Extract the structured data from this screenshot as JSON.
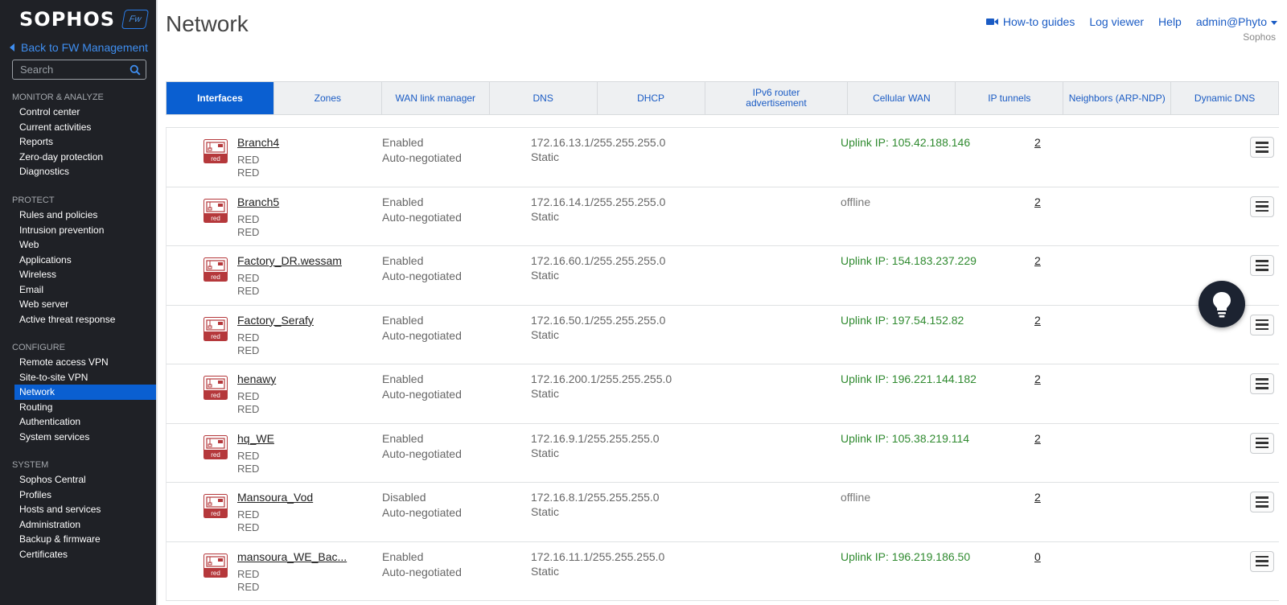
{
  "sidebar": {
    "logo": "SOPHOS",
    "badge": "Fw",
    "back_link": "Back to FW Management",
    "search_placeholder": "Search",
    "sections": {
      "monitor": {
        "heading": "MONITOR & ANALYZE",
        "items": [
          "Control center",
          "Current activities",
          "Reports",
          "Zero-day protection",
          "Diagnostics"
        ]
      },
      "protect": {
        "heading": "PROTECT",
        "items": [
          "Rules and policies",
          "Intrusion prevention",
          "Web",
          "Applications",
          "Wireless",
          "Email",
          "Web server",
          "Active threat response"
        ]
      },
      "configure": {
        "heading": "CONFIGURE",
        "items": [
          "Remote access VPN",
          "Site-to-site VPN",
          "Network",
          "Routing",
          "Authentication",
          "System services"
        ]
      },
      "system": {
        "heading": "SYSTEM",
        "items": [
          "Sophos Central",
          "Profiles",
          "Hosts and services",
          "Administration",
          "Backup & firmware",
          "Certificates"
        ]
      }
    },
    "active_item": "Network"
  },
  "header": {
    "title": "Network",
    "how_to": "How-to guides",
    "log_viewer": "Log viewer",
    "help": "Help",
    "user": "admin@Phyto",
    "org": "Sophos"
  },
  "tabs": [
    {
      "label": "Interfaces",
      "active": true
    },
    {
      "label": "Zones"
    },
    {
      "label": "WAN link manager"
    },
    {
      "label": "DNS"
    },
    {
      "label": "DHCP"
    },
    {
      "label": "IPv6 router advertisement"
    },
    {
      "label": "Cellular WAN"
    },
    {
      "label": "IP tunnels"
    },
    {
      "label": "Neighbors (ARP-NDP)"
    },
    {
      "label": "Dynamic DNS"
    }
  ],
  "rows": [
    {
      "name": "Branch4",
      "type1": "RED",
      "type2": "RED",
      "status": "Enabled",
      "negotiation": "Auto-negotiated",
      "ip": "172.16.13.1/255.255.255.0",
      "mode": "Static",
      "uplink": "Uplink IP: 105.42.188.146",
      "online": true,
      "count": "2",
      "icon_label": "red"
    },
    {
      "name": "Branch5",
      "type1": "RED",
      "type2": "RED",
      "status": "Enabled",
      "negotiation": "Auto-negotiated",
      "ip": "172.16.14.1/255.255.255.0",
      "mode": "Static",
      "uplink": "offline",
      "online": false,
      "count": "2",
      "icon_label": "red"
    },
    {
      "name": "Factory_DR.wessam",
      "type1": "RED",
      "type2": "RED",
      "status": "Enabled",
      "negotiation": "Auto-negotiated",
      "ip": "172.16.60.1/255.255.255.0",
      "mode": "Static",
      "uplink": "Uplink IP: 154.183.237.229",
      "online": true,
      "count": "2",
      "icon_label": "red"
    },
    {
      "name": "Factory_Serafy",
      "type1": "RED",
      "type2": "RED",
      "status": "Enabled",
      "negotiation": "Auto-negotiated",
      "ip": "172.16.50.1/255.255.255.0",
      "mode": "Static",
      "uplink": "Uplink IP: 197.54.152.82",
      "online": true,
      "count": "2",
      "icon_label": "red"
    },
    {
      "name": "henawy",
      "type1": "RED",
      "type2": "RED",
      "status": "Enabled",
      "negotiation": "Auto-negotiated",
      "ip": "172.16.200.1/255.255.255.0",
      "mode": "Static",
      "uplink": "Uplink IP: 196.221.144.182",
      "online": true,
      "count": "2",
      "icon_label": "red"
    },
    {
      "name": "hq_WE",
      "type1": "RED",
      "type2": "RED",
      "status": "Enabled",
      "negotiation": "Auto-negotiated",
      "ip": "172.16.9.1/255.255.255.0",
      "mode": "Static",
      "uplink": "Uplink IP: 105.38.219.114",
      "online": true,
      "count": "2",
      "icon_label": "red"
    },
    {
      "name": "Mansoura_Vod",
      "type1": "RED",
      "type2": "RED",
      "status": "Disabled",
      "negotiation": "Auto-negotiated",
      "ip": "172.16.8.1/255.255.255.0",
      "mode": "Static",
      "uplink": "offline",
      "online": false,
      "count": "2",
      "icon_label": "red"
    },
    {
      "name": "mansoura_WE_Bac...",
      "type1": "RED",
      "type2": "RED",
      "status": "Enabled",
      "negotiation": "Auto-negotiated",
      "ip": "172.16.11.1/255.255.255.0",
      "mode": "Static",
      "uplink": "Uplink IP: 196.219.186.50",
      "online": true,
      "count": "0",
      "icon_label": "red"
    }
  ],
  "colors": {
    "accent": "#0a5fd1",
    "online": "#2f8a2f",
    "link": "#1a5bc4",
    "sidebar": "#1f2126",
    "red_icon": "#b5383b"
  },
  "icons": [
    "search-icon",
    "video-camera-icon",
    "chevron-down-icon",
    "red-interface-icon",
    "hamburger-menu-icon",
    "lightbulb-icon"
  ]
}
